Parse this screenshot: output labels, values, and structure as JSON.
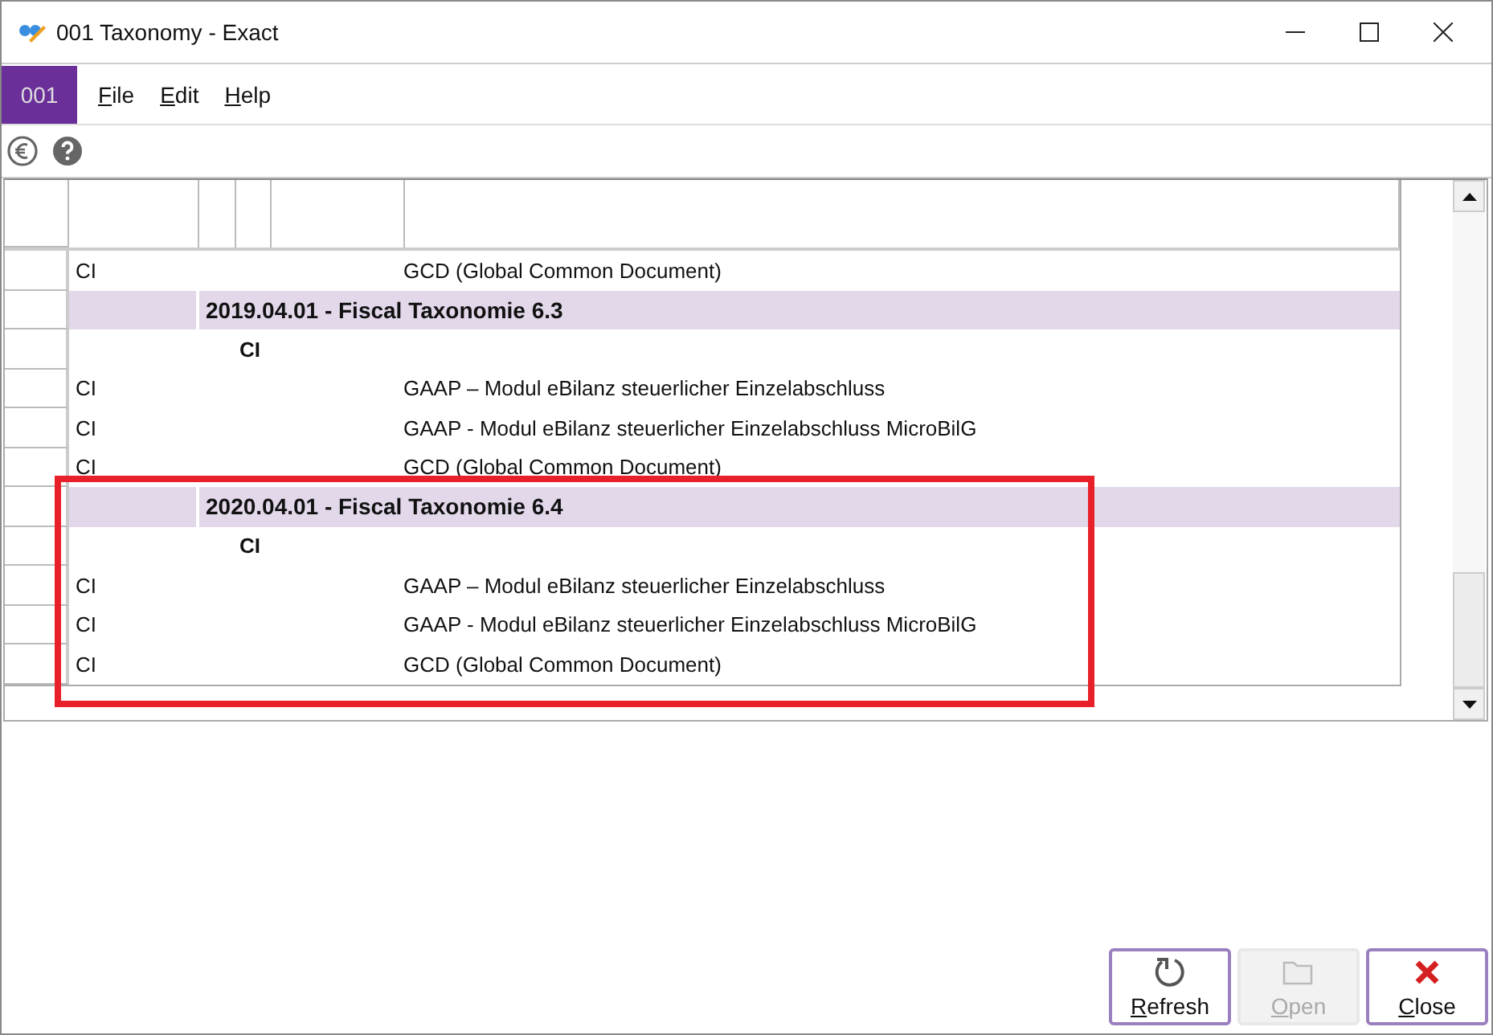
{
  "window": {
    "title": "001 Taxonomy - Exact"
  },
  "company_badge": "001",
  "menu": [
    {
      "label": "File",
      "mnemonic": true
    },
    {
      "label": "Edit",
      "mnemonic": true
    },
    {
      "label": "Help",
      "mnemonic": true
    }
  ],
  "rows": [
    {
      "kind": "item",
      "code": "CI",
      "description": "GCD (Global Common Document)"
    },
    {
      "kind": "group",
      "title": "2019.04.01 - Fiscal Taxonomie 6.3"
    },
    {
      "kind": "sub",
      "code": "CI"
    },
    {
      "kind": "item",
      "code": "CI",
      "description": "GAAP – Modul eBilanz steuerlicher Einzelabschluss"
    },
    {
      "kind": "item",
      "code": "CI",
      "description": "GAAP - Modul eBilanz steuerlicher Einzelabschluss MicroBilG"
    },
    {
      "kind": "item",
      "code": "CI",
      "description": "GCD (Global Common Document)"
    },
    {
      "kind": "group",
      "title": "2020.04.01 - Fiscal Taxonomie 6.4"
    },
    {
      "kind": "sub",
      "code": "CI"
    },
    {
      "kind": "item",
      "code": "CI",
      "description": "GAAP – Modul eBilanz steuerlicher Einzelabschluss"
    },
    {
      "kind": "item",
      "code": "CI",
      "description": "GAAP - Modul eBilanz steuerlicher Einzelabschluss MicroBilG"
    },
    {
      "kind": "item",
      "code": "CI",
      "description": "GCD (Global Common Document)"
    }
  ],
  "buttons": [
    {
      "kind": "refresh",
      "label": "Refresh",
      "disabled": false,
      "mnemonic": true
    },
    {
      "kind": "open",
      "label": "Open",
      "disabled": true,
      "mnemonic": true
    },
    {
      "kind": "close",
      "label": "Close",
      "disabled": false,
      "mnemonic": true
    }
  ]
}
